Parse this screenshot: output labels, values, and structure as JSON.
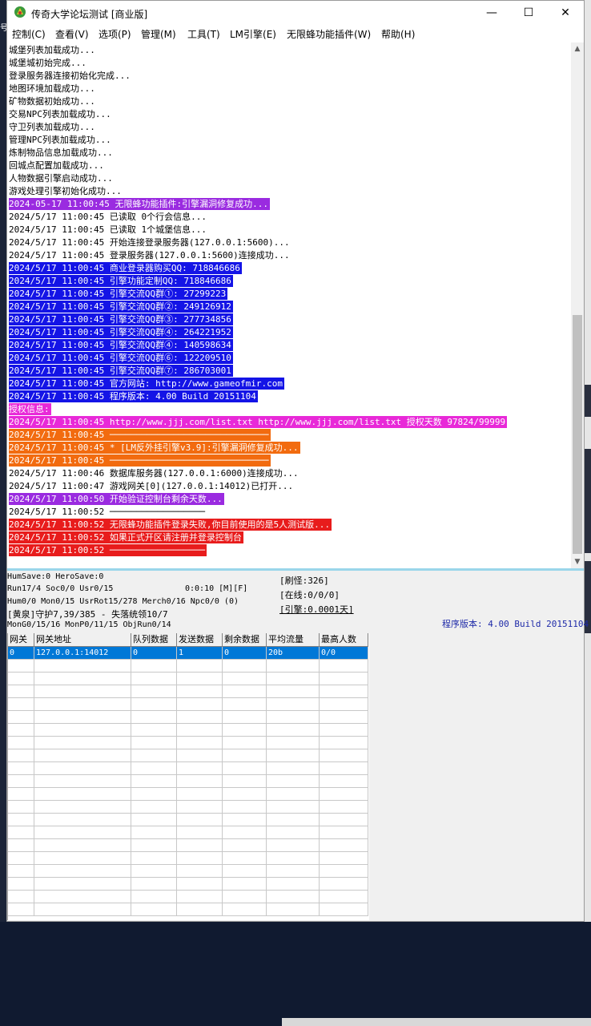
{
  "window": {
    "title": "传奇大学论坛测试 [商业版]",
    "minimize": "—",
    "maximize": "☐",
    "close": "✕"
  },
  "menu": [
    "控制(C)",
    "查看(V)",
    "选项(P)",
    "管理(M)",
    "工具(T)",
    "LM引擎(E)",
    "无限蜂功能插件(W)",
    "帮助(H)"
  ],
  "log": [
    {
      "text": "城堡列表加载成功...",
      "bg": "",
      "fg": "#000000"
    },
    {
      "text": "城堡城初始完成...",
      "bg": "",
      "fg": "#000000"
    },
    {
      "text": "登录服务器连接初始化完成...",
      "bg": "",
      "fg": "#000000"
    },
    {
      "text": "地图环境加载成功...",
      "bg": "",
      "fg": "#000000"
    },
    {
      "text": "矿物数据初始成功...",
      "bg": "",
      "fg": "#000000"
    },
    {
      "text": "交易NPC列表加载成功...",
      "bg": "",
      "fg": "#000000"
    },
    {
      "text": "守卫列表加载成功...",
      "bg": "",
      "fg": "#000000"
    },
    {
      "text": "管理NPC列表加载成功...",
      "bg": "",
      "fg": "#000000"
    },
    {
      "text": "炼制物品信息加载成功...",
      "bg": "",
      "fg": "#000000"
    },
    {
      "text": "回城点配置加载成功...",
      "bg": "",
      "fg": "#000000"
    },
    {
      "text": "人物数据引擎启动成功...",
      "bg": "",
      "fg": "#000000"
    },
    {
      "text": "游戏处理引擎初始化成功...",
      "bg": "",
      "fg": "#000000"
    },
    {
      "text": "2024-05-17 11:00:45 无限蜂功能插件:引擎漏洞修复成功...",
      "bg": "#9a2be0",
      "fg": "#ffffff"
    },
    {
      "text": "2024/5/17 11:00:45 已读取 0个行会信息...",
      "bg": "",
      "fg": "#000000"
    },
    {
      "text": "2024/5/17 11:00:45 已读取 1个城堡信息...",
      "bg": "",
      "fg": "#000000"
    },
    {
      "text": "2024/5/17 11:00:45 开始连接登录服务器(127.0.0.1:5600)...",
      "bg": "",
      "fg": "#000000"
    },
    {
      "text": "2024/5/17 11:00:45 登录服务器(127.0.0.1:5600)连接成功...",
      "bg": "",
      "fg": "#000000"
    },
    {
      "text": "2024/5/17 11:00:45 商业登录器购买QQ: 718846686",
      "bg": "#1414e6",
      "fg": "#ffffff"
    },
    {
      "text": "2024/5/17 11:00:45 引擎功能定制QQ: 718846686",
      "bg": "#1414e6",
      "fg": "#ffffff"
    },
    {
      "text": "2024/5/17 11:00:45 引擎交流QQ群①: 27299223",
      "bg": "#1414e6",
      "fg": "#ffffff"
    },
    {
      "text": "2024/5/17 11:00:45 引擎交流QQ群②: 249126912",
      "bg": "#1414e6",
      "fg": "#ffffff"
    },
    {
      "text": "2024/5/17 11:00:45 引擎交流QQ群③: 277734856",
      "bg": "#1414e6",
      "fg": "#ffffff"
    },
    {
      "text": "2024/5/17 11:00:45 引擎交流QQ群④: 264221952",
      "bg": "#1414e6",
      "fg": "#ffffff"
    },
    {
      "text": "2024/5/17 11:00:45 引擎交流QQ群④: 140598634",
      "bg": "#1414e6",
      "fg": "#ffffff"
    },
    {
      "text": "2024/5/17 11:00:45 引擎交流QQ群⑥: 122209510",
      "bg": "#1414e6",
      "fg": "#ffffff"
    },
    {
      "text": "2024/5/17 11:00:45 引擎交流QQ群⑦: 286703001",
      "bg": "#1414e6",
      "fg": "#ffffff"
    },
    {
      "text": "2024/5/17 11:00:45 官方网站: http://www.gameofmir.com",
      "bg": "#1414e6",
      "fg": "#ffffff"
    },
    {
      "text": "2024/5/17 11:00:45 程序版本: 4.00 Build 20151104",
      "bg": "#1414e6",
      "fg": "#ffffff"
    },
    {
      "text": "授权信息:",
      "bg": "#e829d8",
      "fg": "#ffffff"
    },
    {
      "text": "2024/5/17 11:00:45 http://www.jjj.com/list.txt http://www.jjj.com/list.txt 授权天数 97824/99999",
      "bg": "#e829d8",
      "fg": "#ffffff"
    },
    {
      "text": "2024/5/17 11:00:45 ──────────────────────────────",
      "bg": "#f26b0f",
      "fg": "#ffffff"
    },
    {
      "text": "2024/5/17 11:00:45 * [LM反外挂引擎v3.9]:引擎漏洞修复成功...",
      "bg": "#f26b0f",
      "fg": "#ffffff"
    },
    {
      "text": "2024/5/17 11:00:45 ──────────────────────────────",
      "bg": "#f26b0f",
      "fg": "#ffffff"
    },
    {
      "text": "2024/5/17 11:00:46 数据库服务器(127.0.0.1:6000)连接成功...",
      "bg": "",
      "fg": "#000000"
    },
    {
      "text": "2024/5/17 11:00:47 游戏网关[0](127.0.0.1:14012)已打开...",
      "bg": "",
      "fg": "#000000"
    },
    {
      "text": "2024/5/17 11:00:50 开始验证控制台剩余天数...",
      "bg": "#9a2be0",
      "fg": "#ffffff"
    },
    {
      "text": "2024/5/17 11:00:52 ──────────────────",
      "bg": "",
      "fg": "#000000"
    },
    {
      "text": "2024/5/17 11:00:52 无限蜂功能插件登录失败,你目前使用的是5人测试版...",
      "bg": "#e81c1c",
      "fg": "#ffffff"
    },
    {
      "text": "2024/5/17 11:00:52 如果正式开区请注册并登录控制台",
      "bg": "#e81c1c",
      "fg": "#ffffff"
    },
    {
      "text": "2024/5/17 11:00:52 ──────────────────",
      "bg": "#e81c1c",
      "fg": "#ffffff"
    }
  ],
  "status": {
    "humsave": "HumSave:0 HeroSave:0",
    "run": "Run17/4 Soc0/0 Usr0/15",
    "timer": "0:0:10 [M][F]",
    "hum": "Hum0/0 Mon0/15 UsrRot15/278 Merch0/16 Npc0/0 (0)",
    "guard": "[黄泉]守护7,39/385 - 失落统领10/7",
    "mon": "MonG0/15/16 MonP0/11/15 ObjRun0/14",
    "refresh": "[刷怪:326]",
    "online": "[在线:0/0/0]",
    "engine": "[引擎:0.0001天]",
    "version": "程序版本: 4.00 Build 20151104"
  },
  "grid": {
    "headers": [
      "网关",
      "网关地址",
      "队列数据",
      "发送数据",
      "剩余数据",
      "平均流量",
      "最高人数"
    ],
    "rows": [
      [
        "0",
        "127.0.0.1:14012",
        "0",
        "1",
        "0",
        "20b",
        "0/0"
      ]
    ]
  },
  "colors": {
    "purple": "#9a2be0",
    "blue": "#1414e6",
    "magenta": "#e829d8",
    "orange": "#f26b0f",
    "red": "#e81c1c",
    "selection": "#0078d7"
  }
}
